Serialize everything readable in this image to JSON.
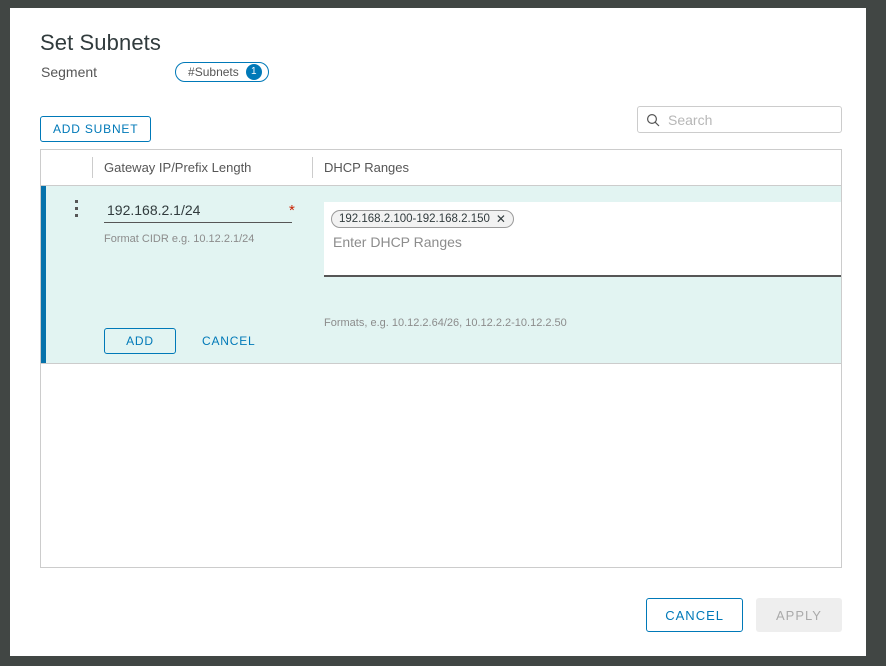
{
  "dialog": {
    "title": "Set Subnets",
    "segment_label": "Segment",
    "subnets_pill_label": "#Subnets",
    "subnets_count": "1"
  },
  "toolbar": {
    "add_subnet_label": "ADD SUBNET",
    "search_placeholder": "Search",
    "search_value": "",
    "search_icon": "search-icon"
  },
  "table": {
    "columns": [
      "Gateway IP/Prefix Length",
      "DHCP Ranges"
    ],
    "editing_row": {
      "menu_icon": "kebab-menu-icon",
      "gateway_value": "192.168.2.1/24",
      "gateway_required_marker": "*",
      "gateway_hint": "Format CIDR e.g. 10.12.2.1/24",
      "dhcp_chips": [
        {
          "label": "192.168.2.100-192.168.2.150",
          "remove_icon": "✕"
        }
      ],
      "dhcp_placeholder": "Enter DHCP Ranges",
      "dhcp_hint": "Formats, e.g. 10.12.2.64/26, 10.12.2.2-10.12.2.50",
      "add_label": "ADD",
      "cancel_label": "CANCEL"
    }
  },
  "footer": {
    "cancel_label": "CANCEL",
    "apply_label": "APPLY"
  },
  "colors": {
    "accent_blue": "#0079b8",
    "row_accent": "#0672ab",
    "row_background": "#e2f4f2",
    "required_red": "#c92100",
    "text_dark": "#313b3d",
    "text_muted": "#8c8c8c"
  }
}
